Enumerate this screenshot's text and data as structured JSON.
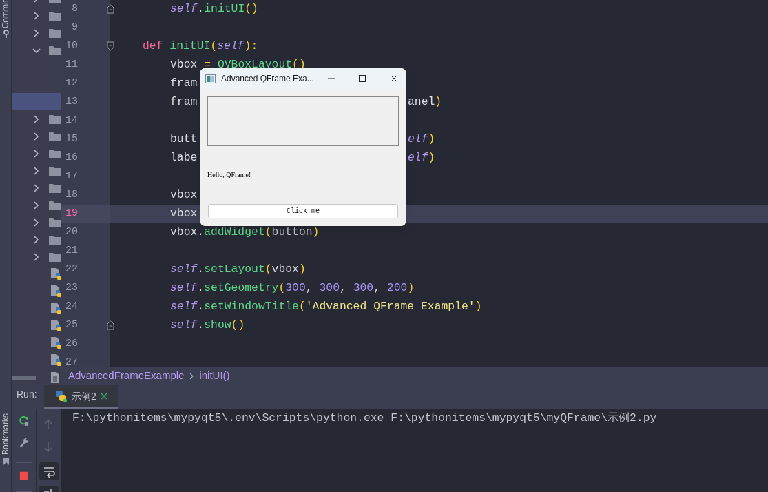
{
  "side_stripe": {
    "top_label": "Commit",
    "bottom_label": "Bookmarks"
  },
  "project_tree": [
    {
      "kind": "folder",
      "expanded": false,
      "selected": false
    },
    {
      "kind": "folder",
      "expanded": false,
      "selected": false
    },
    {
      "kind": "folder",
      "expanded": false,
      "selected": false
    },
    {
      "kind": "folder",
      "expanded": true,
      "selected": false,
      "children": [
        {
          "selected": false
        },
        {
          "selected": false
        },
        {
          "selected": true
        }
      ]
    },
    {
      "kind": "folder",
      "expanded": false,
      "selected": false
    },
    {
      "kind": "folder",
      "expanded": false,
      "selected": false
    },
    {
      "kind": "folder",
      "expanded": false,
      "selected": false
    },
    {
      "kind": "folder",
      "expanded": false,
      "selected": false
    },
    {
      "kind": "folder",
      "expanded": false,
      "selected": false
    },
    {
      "kind": "folder",
      "expanded": false,
      "selected": false
    },
    {
      "kind": "folder",
      "expanded": false,
      "selected": false
    },
    {
      "kind": "folder",
      "expanded": false,
      "selected": false
    },
    {
      "kind": "folder",
      "expanded": false,
      "selected": false
    },
    {
      "kind": "python-file",
      "selected": false
    },
    {
      "kind": "python-file",
      "selected": false
    },
    {
      "kind": "python-file",
      "selected": false
    },
    {
      "kind": "python-file",
      "selected": false
    },
    {
      "kind": "python-file",
      "selected": false
    },
    {
      "kind": "python-file",
      "selected": false
    },
    {
      "kind": "text-file",
      "selected": false
    }
  ],
  "editor": {
    "lines": [
      {
        "number": "8",
        "kind": "body",
        "fold_end": true,
        "tokens": [
          {
            "text": "self",
            "kind": "self"
          },
          {
            "text": ".",
            "kind": "plain"
          },
          {
            "text": "initUI",
            "kind": "fn"
          },
          {
            "text": "()",
            "kind": "paren"
          }
        ]
      },
      {
        "number": "9",
        "kind": "blank"
      },
      {
        "number": "10",
        "kind": "def",
        "fold_start": true,
        "tokens": [
          {
            "text": "def ",
            "kind": "kw"
          },
          {
            "text": "initUI",
            "kind": "fn"
          },
          {
            "text": "(",
            "kind": "paren"
          },
          {
            "text": "self",
            "kind": "self"
          },
          {
            "text": "):",
            "kind": "paren"
          }
        ]
      },
      {
        "number": "11",
        "kind": "body",
        "tokens": [
          {
            "text": "vbox ",
            "kind": "plain"
          },
          {
            "text": "= ",
            "kind": "op"
          },
          {
            "text": "QVBoxLayout",
            "kind": "fn"
          },
          {
            "text": "()",
            "kind": "paren"
          }
        ]
      },
      {
        "number": "12",
        "kind": "body",
        "tokens": [
          {
            "text": "fram",
            "kind": "plain"
          }
        ]
      },
      {
        "number": "13",
        "kind": "body",
        "tokens": [
          {
            "text": "fram",
            "kind": "plain"
          }
        ],
        "right": [
          {
            "text": "anel",
            "kind": "plain"
          },
          {
            "text": ")",
            "kind": "paren"
          }
        ]
      },
      {
        "number": "14",
        "kind": "blank"
      },
      {
        "number": "15",
        "kind": "body",
        "tokens": [
          {
            "text": "butt",
            "kind": "plain"
          }
        ],
        "right": [
          {
            "text": "elf",
            "kind": "self"
          },
          {
            "text": ")",
            "kind": "paren"
          }
        ]
      },
      {
        "number": "16",
        "kind": "body",
        "tokens": [
          {
            "text": "labe",
            "kind": "plain"
          }
        ],
        "right": [
          {
            "text": "elf",
            "kind": "self"
          },
          {
            "text": ")",
            "kind": "paren"
          }
        ]
      },
      {
        "number": "17",
        "kind": "blank"
      },
      {
        "number": "18",
        "kind": "body",
        "tokens": [
          {
            "text": "vbox",
            "kind": "plain"
          }
        ]
      },
      {
        "number": "19",
        "kind": "body",
        "current": true,
        "tokens": [
          {
            "text": "vbox",
            "kind": "plain"
          }
        ]
      },
      {
        "number": "20",
        "kind": "body",
        "tokens": [
          {
            "text": "vbox.",
            "kind": "plain"
          },
          {
            "text": "addWidget",
            "kind": "fn"
          },
          {
            "text": "(",
            "kind": "paren"
          },
          {
            "text": "button",
            "kind": "arg"
          },
          {
            "text": ")",
            "kind": "paren"
          }
        ]
      },
      {
        "number": "21",
        "kind": "blank"
      },
      {
        "number": "22",
        "kind": "body",
        "tokens": [
          {
            "text": "self",
            "kind": "self"
          },
          {
            "text": ".",
            "kind": "plain"
          },
          {
            "text": "setLayout",
            "kind": "fn"
          },
          {
            "text": "(",
            "kind": "paren"
          },
          {
            "text": "vbox",
            "kind": "plain"
          },
          {
            "text": ")",
            "kind": "paren"
          }
        ]
      },
      {
        "number": "23",
        "kind": "body",
        "tokens": [
          {
            "text": "self",
            "kind": "self"
          },
          {
            "text": ".",
            "kind": "plain"
          },
          {
            "text": "setGeometry",
            "kind": "fn"
          },
          {
            "text": "(",
            "kind": "paren"
          },
          {
            "text": "300",
            "kind": "num"
          },
          {
            "text": ", ",
            "kind": "plain"
          },
          {
            "text": "300",
            "kind": "num"
          },
          {
            "text": ", ",
            "kind": "plain"
          },
          {
            "text": "300",
            "kind": "num"
          },
          {
            "text": ", ",
            "kind": "plain"
          },
          {
            "text": "200",
            "kind": "num"
          },
          {
            "text": ")",
            "kind": "paren"
          }
        ]
      },
      {
        "number": "24",
        "kind": "body",
        "tokens": [
          {
            "text": "self",
            "kind": "self"
          },
          {
            "text": ".",
            "kind": "plain"
          },
          {
            "text": "setWindowTitle",
            "kind": "fn"
          },
          {
            "text": "(",
            "kind": "paren"
          },
          {
            "text": "'Advanced QFrame Example'",
            "kind": "str"
          },
          {
            "text": ")",
            "kind": "paren"
          }
        ]
      },
      {
        "number": "25",
        "kind": "body",
        "fold_end": true,
        "tokens": [
          {
            "text": "self",
            "kind": "self"
          },
          {
            "text": ".",
            "kind": "plain"
          },
          {
            "text": "show",
            "kind": "fn"
          },
          {
            "text": "()",
            "kind": "paren"
          }
        ]
      },
      {
        "number": "26",
        "kind": "blank"
      },
      {
        "number": "27",
        "kind": "blank"
      }
    ],
    "breadcrumb": [
      "AdvancedFrameExample",
      "initUI()"
    ]
  },
  "app_window": {
    "title": "Advanced QFrame Exa...",
    "label": "Hello, QFrame!",
    "button": "Click me"
  },
  "run_panel": {
    "label": "Run:",
    "tabs": [
      {
        "label": "示例2",
        "selected": true
      }
    ],
    "left_tools": [
      {
        "kind": "rerun"
      },
      {
        "kind": "wrench"
      },
      {
        "kind": "stop"
      }
    ],
    "right_tools": [
      {
        "kind": "up",
        "disabled": true
      },
      {
        "kind": "down",
        "disabled": true
      },
      {
        "kind": "wrap",
        "on": true
      },
      {
        "kind": "scroll-end",
        "on": true
      }
    ],
    "console": [
      "F:\\pythonitems\\mypyqt5\\.env\\Scripts\\python.exe F:\\pythonitems\\mypyqt5\\myQFrame\\示例2.py"
    ]
  }
}
